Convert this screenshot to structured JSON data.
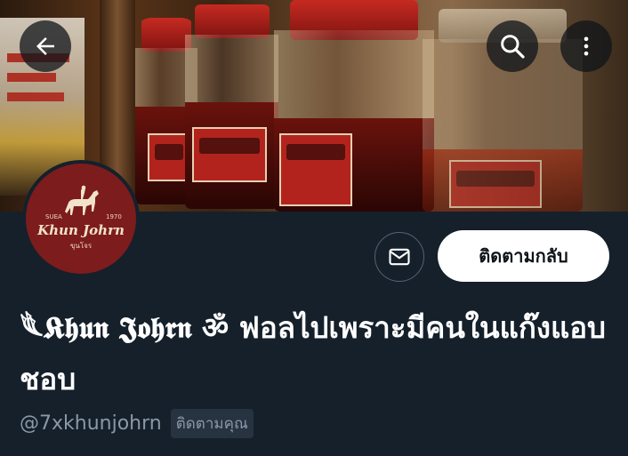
{
  "header": {
    "back_icon": "arrow-left-icon",
    "search_icon": "search-icon",
    "more_icon": "more-vertical-icon"
  },
  "avatar": {
    "brand": "Khun Johrn",
    "left_text": "SUEA",
    "right_text": "1970",
    "sub_text": "ขุนโจร"
  },
  "actions": {
    "message_icon": "envelope-icon",
    "follow_back_label": "ติดตามกลับ"
  },
  "profile": {
    "display_name": "𓆰𝕶𝖍𝖚𝖓 𝕵𝖔𝖍𝖗𝖓 ॐ ฟอลไปเพราะมีคนในแก๊งแอบชอบ",
    "handle": "@7xkhunjohrn",
    "follows_you": "ติดตามคุณ"
  },
  "colors": {
    "background": "#15202b",
    "button_bg": "#ffffff",
    "muted_text": "#8b98a5",
    "badge_bg": "#273340",
    "avatar_bg": "#7d1c1c"
  }
}
